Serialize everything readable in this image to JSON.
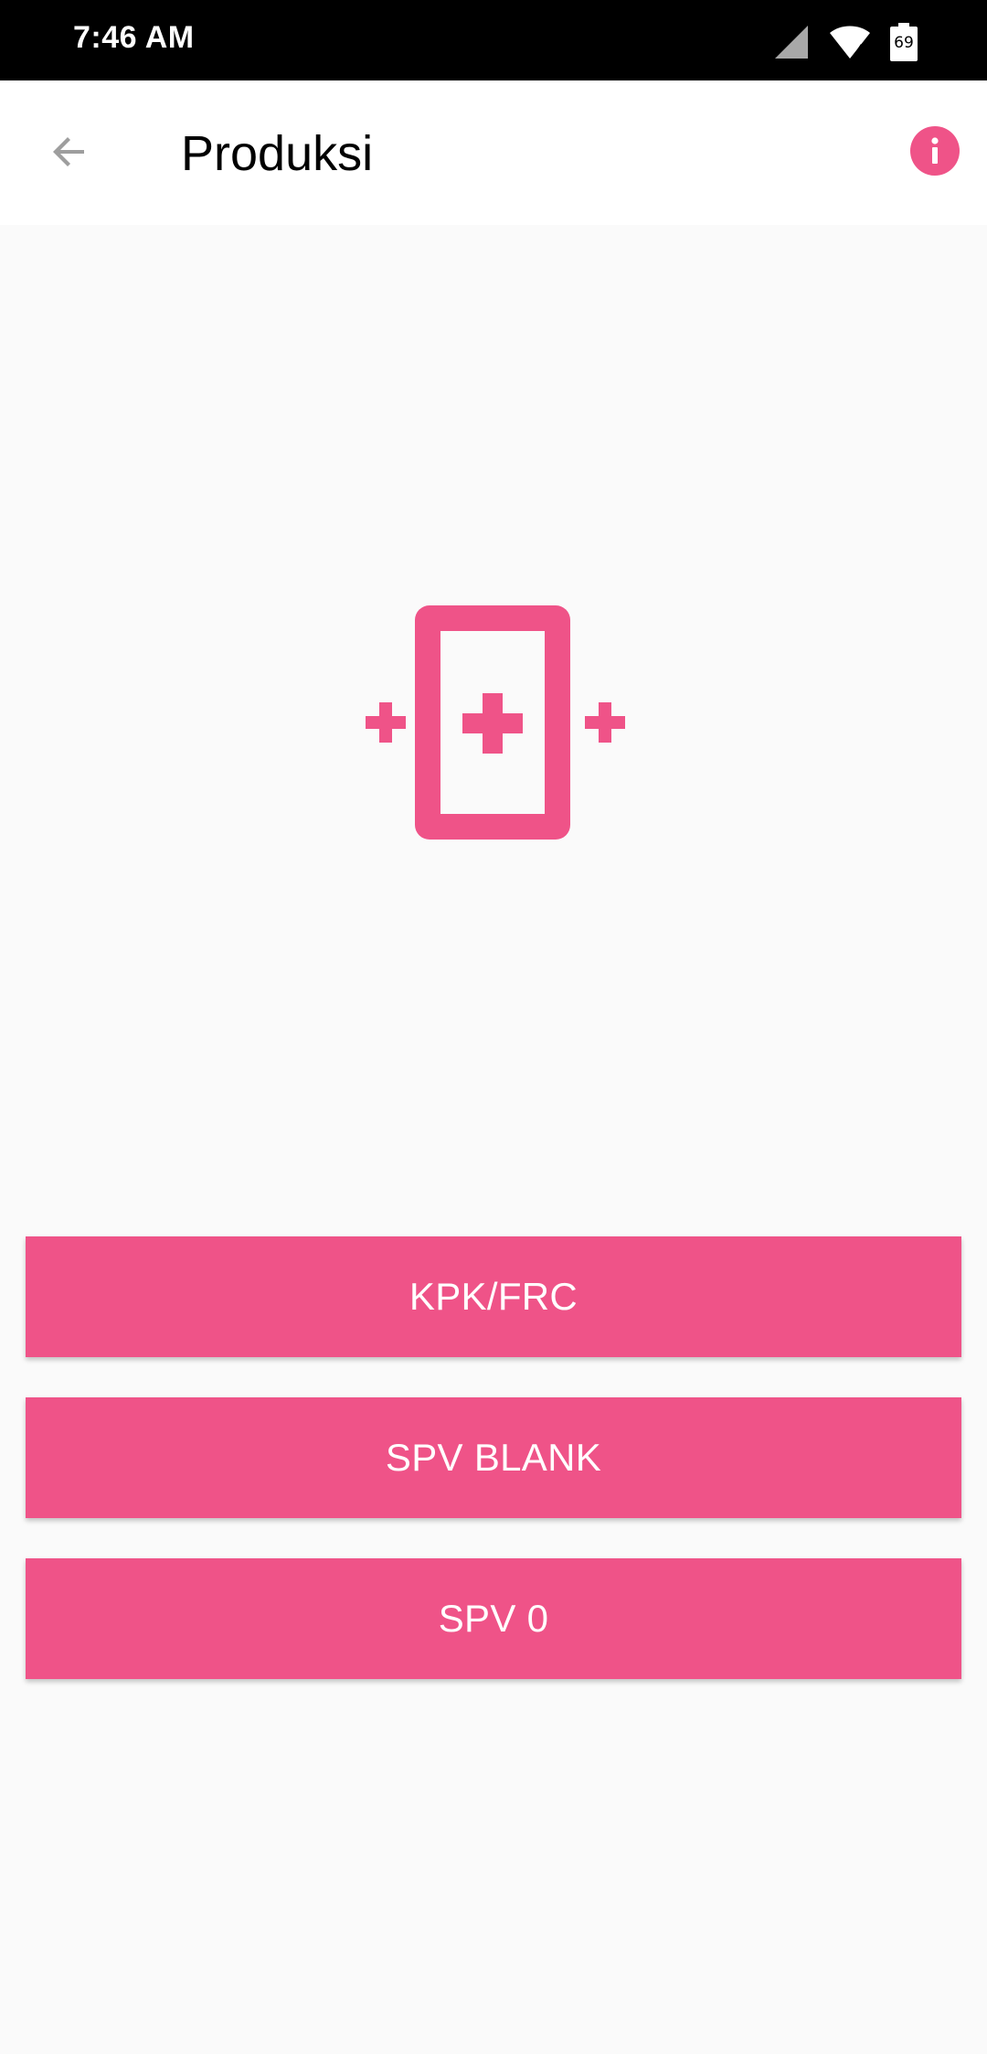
{
  "status_bar": {
    "time": "7:46 AM",
    "battery_level": "69",
    "icons": [
      "signal-icon",
      "wifi-icon",
      "battery-icon"
    ]
  },
  "app_bar": {
    "title": "Produksi",
    "back_icon": "arrow-back-icon",
    "info_icon": "info-icon"
  },
  "hero": {
    "icon": "phone-plus-icon"
  },
  "buttons": [
    {
      "label": "KPK/FRC"
    },
    {
      "label": "SPV BLANK"
    },
    {
      "label": "SPV 0"
    }
  ],
  "colors": {
    "accent": "#ef5388",
    "status_bar": "#000000",
    "app_bar": "#ffffff",
    "background": "#fafafa"
  }
}
